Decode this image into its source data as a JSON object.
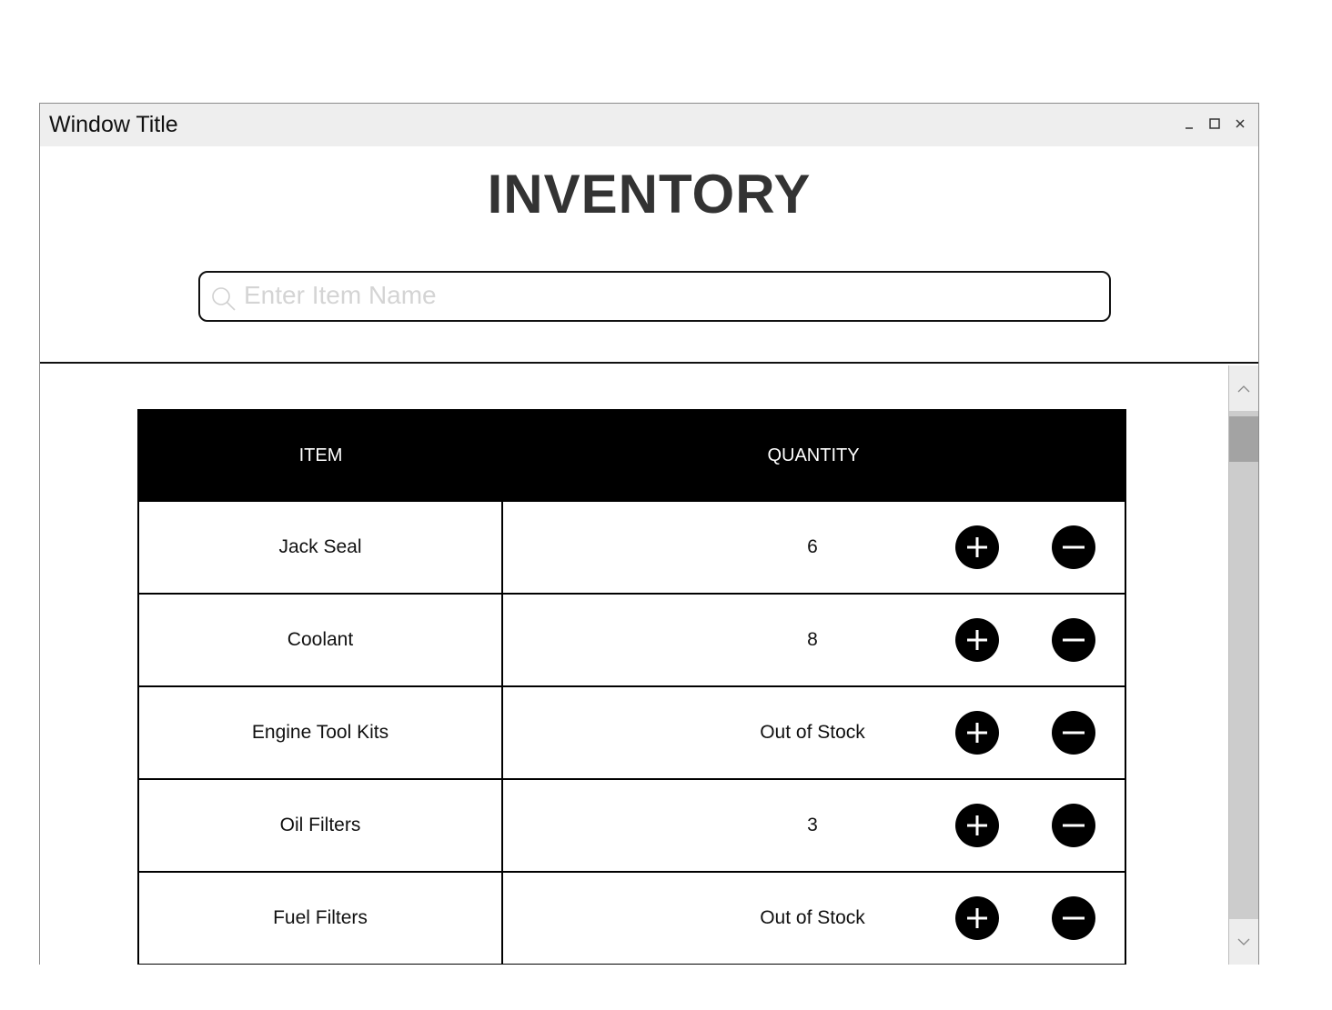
{
  "window": {
    "title": "Window Title"
  },
  "app": {
    "title": "INVENTORY"
  },
  "search": {
    "placeholder": "Enter Item Name",
    "value": ""
  },
  "table": {
    "columns": [
      "ITEM",
      "QUANTITY"
    ],
    "rows": [
      {
        "item": "Jack Seal",
        "quantity": "6"
      },
      {
        "item": "Coolant",
        "quantity": "8"
      },
      {
        "item": "Engine Tool Kits",
        "quantity": "Out of Stock"
      },
      {
        "item": "Oil Filters",
        "quantity": "3"
      },
      {
        "item": "Fuel Filters",
        "quantity": "Out of Stock"
      }
    ],
    "row_actions": [
      "plus-icon",
      "minus-icon"
    ]
  },
  "icons": {
    "search": "search-icon",
    "minimize": "minimize-icon",
    "maximize": "maximize-icon",
    "close": "close-icon",
    "scroll_up": "chevron-up-icon",
    "scroll_down": "chevron-down-icon"
  },
  "colors": {
    "titlebar_bg": "#eeeeee",
    "header_bg": "#000000",
    "header_text": "#ffffff",
    "title_text": "#333333",
    "placeholder": "#d4d4d4",
    "scrollbar_track": "#cccccc",
    "scrollbar_thumb": "#a3a3a3"
  }
}
